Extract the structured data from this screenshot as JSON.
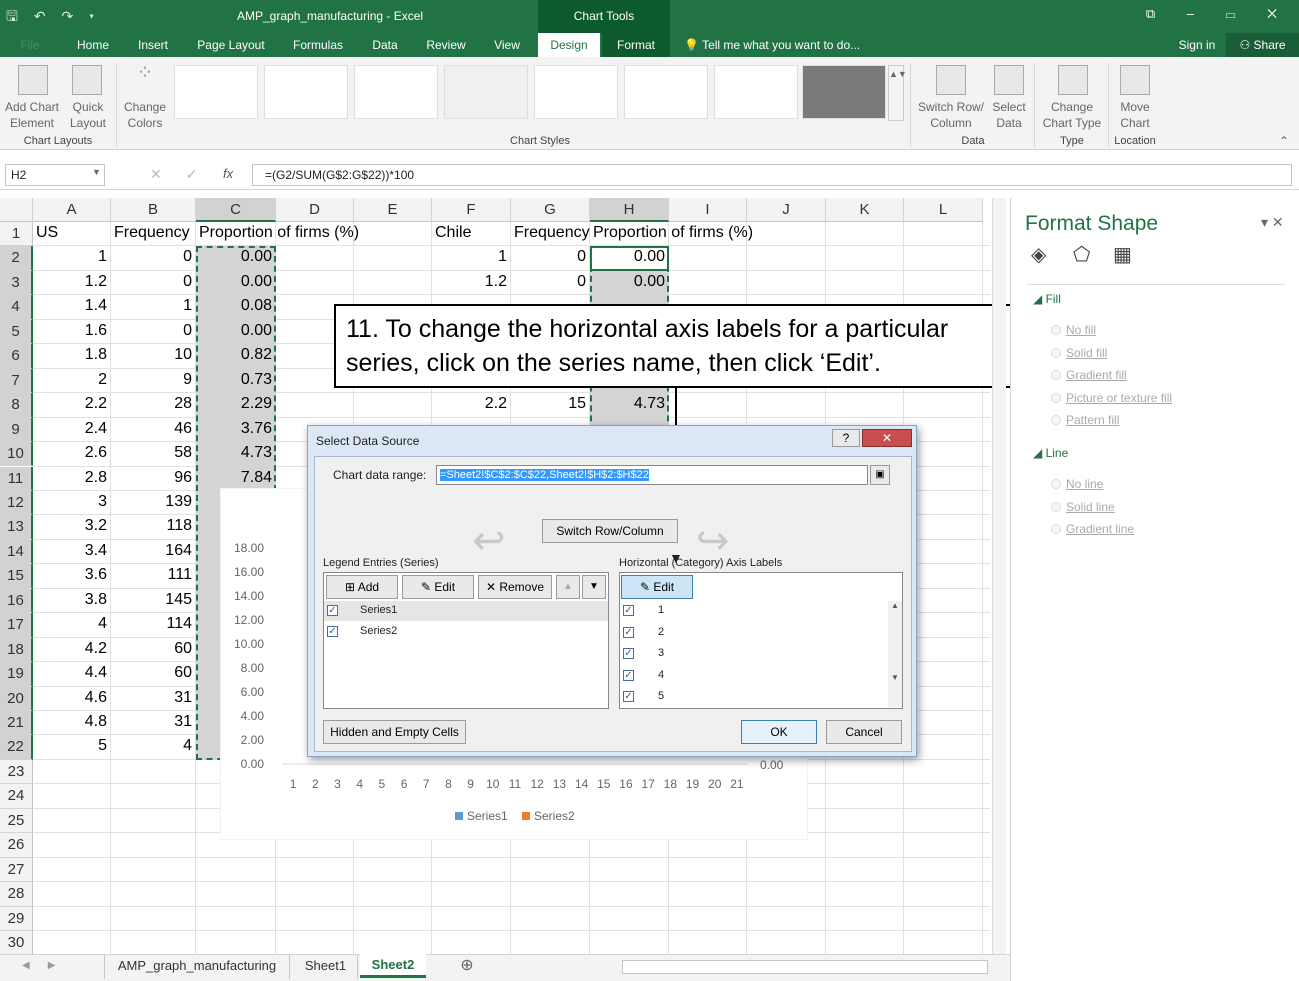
{
  "window": {
    "title": "AMP_graph_manufacturing - Excel",
    "chart_tools": "Chart Tools",
    "qat": "🖫 ↶ ↷ ▾",
    "controls": "⧉ – ▭ ✕"
  },
  "tabs": {
    "file": "File",
    "home": "Home",
    "insert": "Insert",
    "page_layout": "Page Layout",
    "formulas": "Formulas",
    "data": "Data",
    "review": "Review",
    "view": "View",
    "design": "Design",
    "format": "Format",
    "tell_me": "Tell me what you want to do...",
    "sign_in": "Sign in",
    "share": "Share"
  },
  "ribbon": {
    "add_chart": "Add Chart Element",
    "quick_layout": "Quick Layout",
    "change_colors": "Change Colors",
    "chart_layouts": "Chart Layouts",
    "chart_styles": "Chart Styles",
    "switch_row": "Switch Row/ Column",
    "select_data": "Select Data",
    "data_group": "Data",
    "change_type": "Change Chart Type",
    "type_group": "Type",
    "move_chart": "Move Chart",
    "location_group": "Location"
  },
  "formula_bar": {
    "name_box": "H2",
    "formula": "=(G2/SUM(G$2:G$22))*100",
    "fx": "fx"
  },
  "columns": [
    "A",
    "B",
    "C",
    "D",
    "E",
    "F",
    "G",
    "H",
    "I",
    "J",
    "K",
    "L"
  ],
  "rows": [
    "1",
    "2",
    "3",
    "4",
    "5",
    "6",
    "7",
    "8",
    "9",
    "10",
    "11",
    "12",
    "13",
    "14",
    "15",
    "16",
    "17",
    "18",
    "19",
    "20",
    "21",
    "22",
    "23",
    "24",
    "25",
    "26",
    "27",
    "28",
    "29",
    "30"
  ],
  "headers": {
    "a1": "US",
    "b1": "Frequency",
    "c1": "Proportion of firms (%)",
    "f1": "Chile",
    "g1": "Frequency",
    "h1": "Proportion of firms (%)"
  },
  "col_a": [
    "1",
    "1.2",
    "1.4",
    "1.6",
    "1.8",
    "2",
    "2.2",
    "2.4",
    "2.6",
    "2.8",
    "3",
    "3.2",
    "3.4",
    "3.6",
    "3.8",
    "4",
    "4.2",
    "4.4",
    "4.6",
    "4.8",
    "5"
  ],
  "col_b": [
    "0",
    "0",
    "1",
    "0",
    "10",
    "9",
    "28",
    "46",
    "58",
    "96",
    "139",
    "118",
    "164",
    "111",
    "145",
    "114",
    "60",
    "60",
    "31",
    "31",
    "4"
  ],
  "col_c": [
    "0.00",
    "0.00",
    "0.08",
    "0.00",
    "0.82",
    "0.73",
    "2.29",
    "3.76",
    "4.73",
    "7.84"
  ],
  "col_f": [
    "1",
    "1.2",
    "2.2"
  ],
  "col_g": [
    "0",
    "0",
    "15"
  ],
  "col_h": [
    "0.00",
    "0.00",
    "4.73"
  ],
  "chart": {
    "yticks": [
      "18.00",
      "16.00",
      "14.00",
      "12.00",
      "10.00",
      "8.00",
      "6.00",
      "4.00",
      "2.00",
      "0.00"
    ],
    "xticks": [
      "1",
      "2",
      "3",
      "4",
      "5",
      "6",
      "7",
      "8",
      "9",
      "10",
      "11",
      "12",
      "13",
      "14",
      "15",
      "16",
      "17",
      "18",
      "19",
      "20",
      "21"
    ],
    "series1": "Series1",
    "series2": "Series2",
    "right_zero": "0.00",
    "colors": {
      "series1": "#5b9bd5",
      "series2": "#ed7d31"
    }
  },
  "callout": "11. To change the horizontal axis labels for a particular series, click on the series name, then click ‘Edit’.",
  "dialog": {
    "title": "Select Data Source",
    "help": "?",
    "close": "✕",
    "range_label": "Chart data range:",
    "range_value": "=Sheet2!$C$2:$C$22,Sheet2!$H$2:$H$22",
    "switch": "Switch Row/Column",
    "legend_label": "Legend Entries (Series)",
    "add": "Add",
    "edit": "Edit",
    "remove": "Remove",
    "up": "▲",
    "down": "▼",
    "series": [
      "Series1",
      "Series2"
    ],
    "axis_label": "Horizontal (Category) Axis Labels",
    "axis_edit": "Edit",
    "axis_items": [
      "1",
      "2",
      "3",
      "4",
      "5"
    ],
    "hidden": "Hidden and Empty Cells",
    "ok": "OK",
    "cancel": "Cancel"
  },
  "format_shape": {
    "title": "Format Shape",
    "fill": "Fill",
    "fill_opts": [
      "No fill",
      "Solid fill",
      "Gradient fill",
      "Picture or texture fill",
      "Pattern fill"
    ],
    "line": "Line",
    "line_opts": [
      "No line",
      "Solid line",
      "Gradient line"
    ]
  },
  "sheets": {
    "s1": "AMP_graph_manufacturing",
    "s2": "Sheet1",
    "s3": "Sheet2",
    "add": "⊕"
  }
}
